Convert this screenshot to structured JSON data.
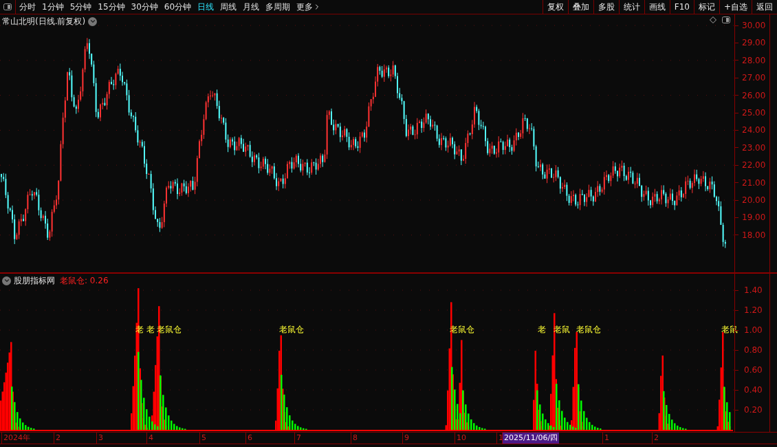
{
  "toolbar": {
    "periods": [
      {
        "label": "分时",
        "selected": false
      },
      {
        "label": "1分钟",
        "selected": false
      },
      {
        "label": "5分钟",
        "selected": false
      },
      {
        "label": "15分钟",
        "selected": false
      },
      {
        "label": "30分钟",
        "selected": false
      },
      {
        "label": "60分钟",
        "selected": false
      },
      {
        "label": "日线",
        "selected": true
      },
      {
        "label": "周线",
        "selected": false
      },
      {
        "label": "月线",
        "selected": false
      },
      {
        "label": "多周期",
        "selected": false
      }
    ],
    "more": "更多",
    "actions": [
      "复权",
      "叠加",
      "多股",
      "统计",
      "画线",
      "F10",
      "标记",
      "+自选",
      "返回"
    ]
  },
  "stock_title": "常山北明(日线.前复权)",
  "price_axis": {
    "ticks": [
      "30.00",
      "29.00",
      "28.00",
      "27.00",
      "26.00",
      "25.00",
      "24.00",
      "23.00",
      "22.00",
      "21.00",
      "20.00",
      "19.00",
      "18.00"
    ]
  },
  "indicator": {
    "source": "股朋指标网",
    "reading": "老鼠仓: 0.26",
    "ticks": [
      "1.40",
      "1.20",
      "1.00",
      "0.80",
      "0.60",
      "0.40",
      "0.20"
    ],
    "signal_labels": [
      "老",
      "老",
      "老鼠仓",
      "老鼠仓",
      "老鼠仓",
      "老",
      "老鼠",
      "老鼠仓",
      "老鼠"
    ]
  },
  "time_axis": {
    "labels": [
      {
        "text": "2024年",
        "selected": false
      },
      {
        "text": "2",
        "selected": false
      },
      {
        "text": "3",
        "selected": false
      },
      {
        "text": "4",
        "selected": false
      },
      {
        "text": "5",
        "selected": false
      },
      {
        "text": "6",
        "selected": false
      },
      {
        "text": "7",
        "selected": false
      },
      {
        "text": "8",
        "selected": false
      },
      {
        "text": "9",
        "selected": false
      },
      {
        "text": "10",
        "selected": false
      },
      {
        "text": "1",
        "selected": false
      },
      {
        "text": "2025/11/06/四",
        "selected": true
      },
      {
        "text": "1",
        "selected": false
      },
      {
        "text": "2",
        "selected": false
      }
    ]
  }
}
